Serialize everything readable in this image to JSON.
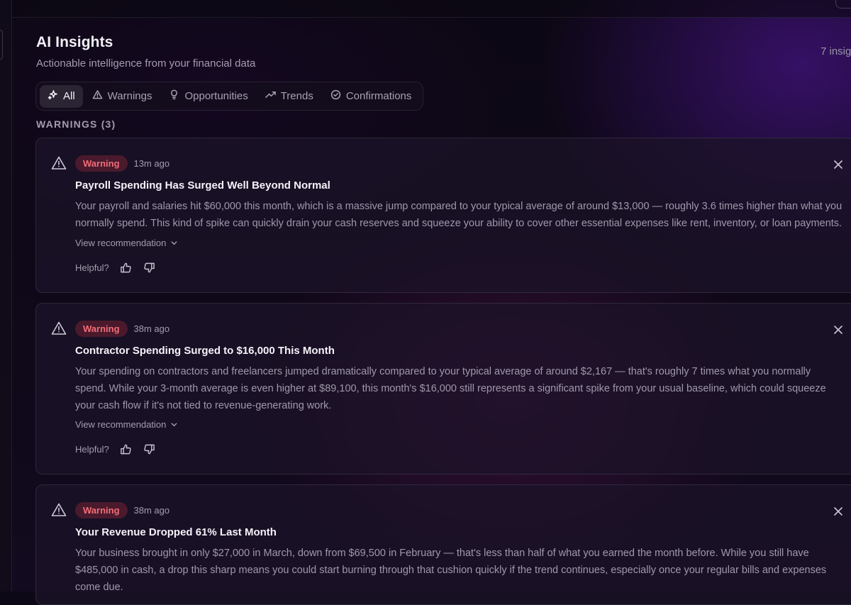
{
  "page": {
    "title": "AI Insights",
    "subtitle": "Actionable intelligence from your financial data",
    "insight_count": "7 insig"
  },
  "tabs": [
    {
      "label": "All",
      "icon": "sparkles-icon",
      "active": true
    },
    {
      "label": "Warnings",
      "icon": "warning-triangle-icon",
      "active": false
    },
    {
      "label": "Opportunities",
      "icon": "lightbulb-icon",
      "active": false
    },
    {
      "label": "Trends",
      "icon": "trending-up-icon",
      "active": false
    },
    {
      "label": "Confirmations",
      "icon": "check-circle-icon",
      "active": false
    }
  ],
  "section": {
    "label": "WARNINGS (3)"
  },
  "insights": [
    {
      "badge": "Warning",
      "time": "13m ago",
      "title": "Payroll Spending Has Surged Well Beyond Normal",
      "body": "Your payroll and salaries hit $60,000 this month, which is a massive jump compared to your typical average of around $13,000 — roughly 3.6 times higher than what you normally spend. This kind of spike can quickly drain your cash reserves and squeeze your ability to cover other essential expenses like rent, inventory, or loan payments.",
      "view_recommendation": "View recommendation",
      "helpful_label": "Helpful?"
    },
    {
      "badge": "Warning",
      "time": "38m ago",
      "title": "Contractor Spending Surged to $16,000 This Month",
      "body": "Your spending on contractors and freelancers jumped dramatically compared to your typical average of around $2,167 — that's roughly 7 times what you normally spend. While your 3-month average is even higher at $89,100, this month's $16,000 still represents a significant spike from your usual baseline, which could squeeze your cash flow if it's not tied to revenue-generating work.",
      "view_recommendation": "View recommendation",
      "helpful_label": "Helpful?"
    },
    {
      "badge": "Warning",
      "time": "38m ago",
      "title": "Your Revenue Dropped 61% Last Month",
      "body": "Your business brought in only $27,000 in March, down from $69,500 in February — that's less than half of what you earned the month before. While you still have $485,000 in cash, a drop this sharp means you could start burning through that cushion quickly if the trend continues, especially once your regular bills and expenses come due."
    }
  ],
  "colors": {
    "badge_text": "#f06d78",
    "badge_bg": "#5a1f2e",
    "accent_glow": "#5818a8"
  }
}
